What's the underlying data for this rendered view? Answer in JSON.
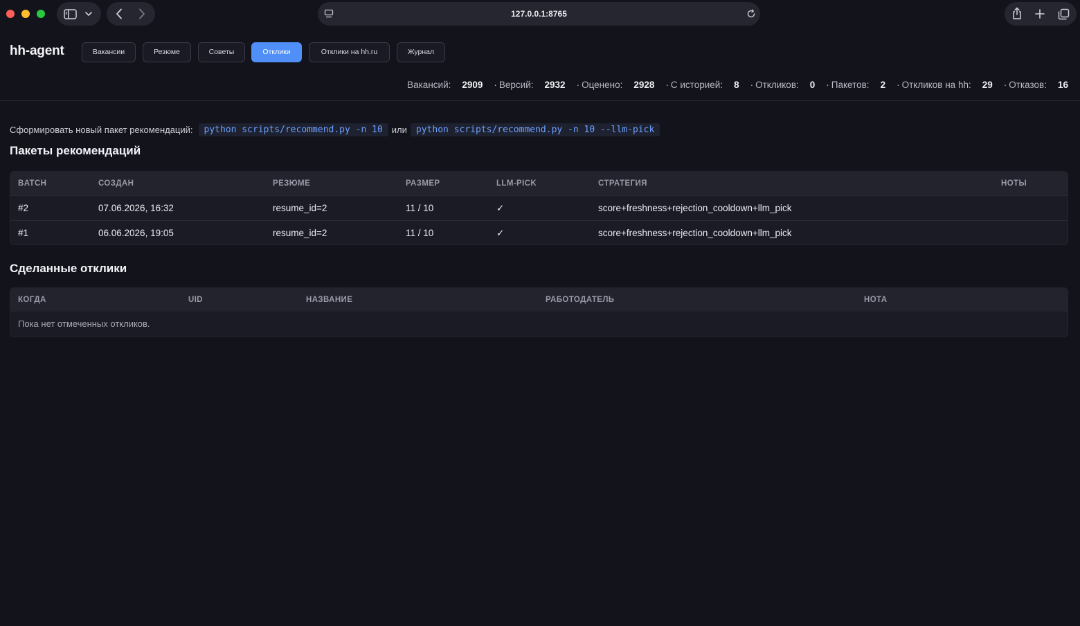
{
  "browser": {
    "url": "127.0.0.1:8765"
  },
  "app": {
    "brand": "hh-agent",
    "nav": [
      {
        "label": "Вакансии",
        "active": false
      },
      {
        "label": "Резюме",
        "active": false
      },
      {
        "label": "Советы",
        "active": false
      },
      {
        "label": "Отклики",
        "active": true
      },
      {
        "label": "Отклики на hh.ru",
        "active": false
      },
      {
        "label": "Журнал",
        "active": false
      }
    ],
    "accent_color": "#4f8ff7"
  },
  "stats": [
    {
      "label": "Вакансий:",
      "value": "2909"
    },
    {
      "label": "Версий:",
      "value": "2932"
    },
    {
      "label": "Оценено:",
      "value": "2928"
    },
    {
      "label": "С историей:",
      "value": "8"
    },
    {
      "label": "Откликов:",
      "value": "0"
    },
    {
      "label": "Пакетов:",
      "value": "2"
    },
    {
      "label": "Откликов на hh:",
      "value": "29"
    },
    {
      "label": "Отказов:",
      "value": "16"
    }
  ],
  "hint": {
    "prefix": "Сформировать новый пакет рекомендаций:",
    "cmd1": "python scripts/recommend.py -n 10",
    "or": "или",
    "cmd2": "python scripts/recommend.py -n 10 --llm-pick"
  },
  "batches": {
    "title": "Пакеты рекомендаций",
    "columns": [
      "BATCH",
      "СОЗДАН",
      "РЕЗЮМЕ",
      "РАЗМЕР",
      "LLM-PICK",
      "СТРАТЕГИЯ",
      "НОТЫ"
    ],
    "rows": [
      {
        "batch": "#2",
        "created": "07.06.2026, 16:32",
        "resume": "resume_id=2",
        "size": "11 / 10",
        "llm_pick": "✓",
        "strategy": "score+freshness+rejection_cooldown+llm_pick",
        "notes": ""
      },
      {
        "batch": "#1",
        "created": "06.06.2026, 19:05",
        "resume": "resume_id=2",
        "size": "11 / 10",
        "llm_pick": "✓",
        "strategy": "score+freshness+rejection_cooldown+llm_pick",
        "notes": ""
      }
    ]
  },
  "responses": {
    "title": "Сделанные отклики",
    "columns": [
      "КОГДА",
      "UID",
      "НАЗВАНИЕ",
      "РАБОТОДАТЕЛЬ",
      "НОТА"
    ],
    "empty": "Пока нет отмеченных откликов."
  }
}
